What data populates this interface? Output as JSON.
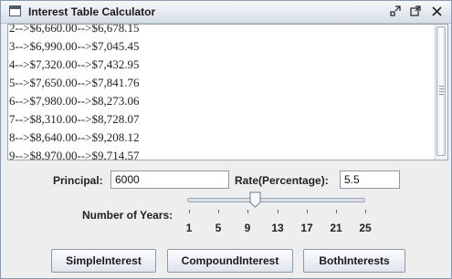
{
  "window": {
    "title": "Interest Table Calculator"
  },
  "titlebar_icons": {
    "minimize": "minimize-icon",
    "maximize": "maximize-icon",
    "close": "close-icon"
  },
  "output_lines": [
    "2-->$6,660.00-->$6,678.15",
    "3-->$6,990.00-->$7,045.45",
    "4-->$7,320.00-->$7,432.95",
    "5-->$7,650.00-->$7,841.76",
    "6-->$7,980.00-->$8,273.06",
    "7-->$8,310.00-->$8,728.07",
    "8-->$8,640.00-->$9,208.12",
    "9-->$8,970.00-->$9,714.57"
  ],
  "form": {
    "principal_label": "Principal:",
    "principal_value": "6000",
    "rate_label": "Rate(Percentage):",
    "rate_value": "5.5",
    "years_label": "Number of Years:"
  },
  "slider": {
    "min": 1,
    "max": 25,
    "value": 10,
    "tick_labels": [
      "1",
      "5",
      "9",
      "13",
      "17",
      "21",
      "25"
    ]
  },
  "buttons": {
    "simple": "SimpleInterest",
    "compound": "CompoundInterest",
    "both": "BothInterests"
  },
  "colors": {
    "title_bar": "#d7dde6",
    "panel_bg": "#eeeeee",
    "button_bg": "#dfe5ec"
  }
}
